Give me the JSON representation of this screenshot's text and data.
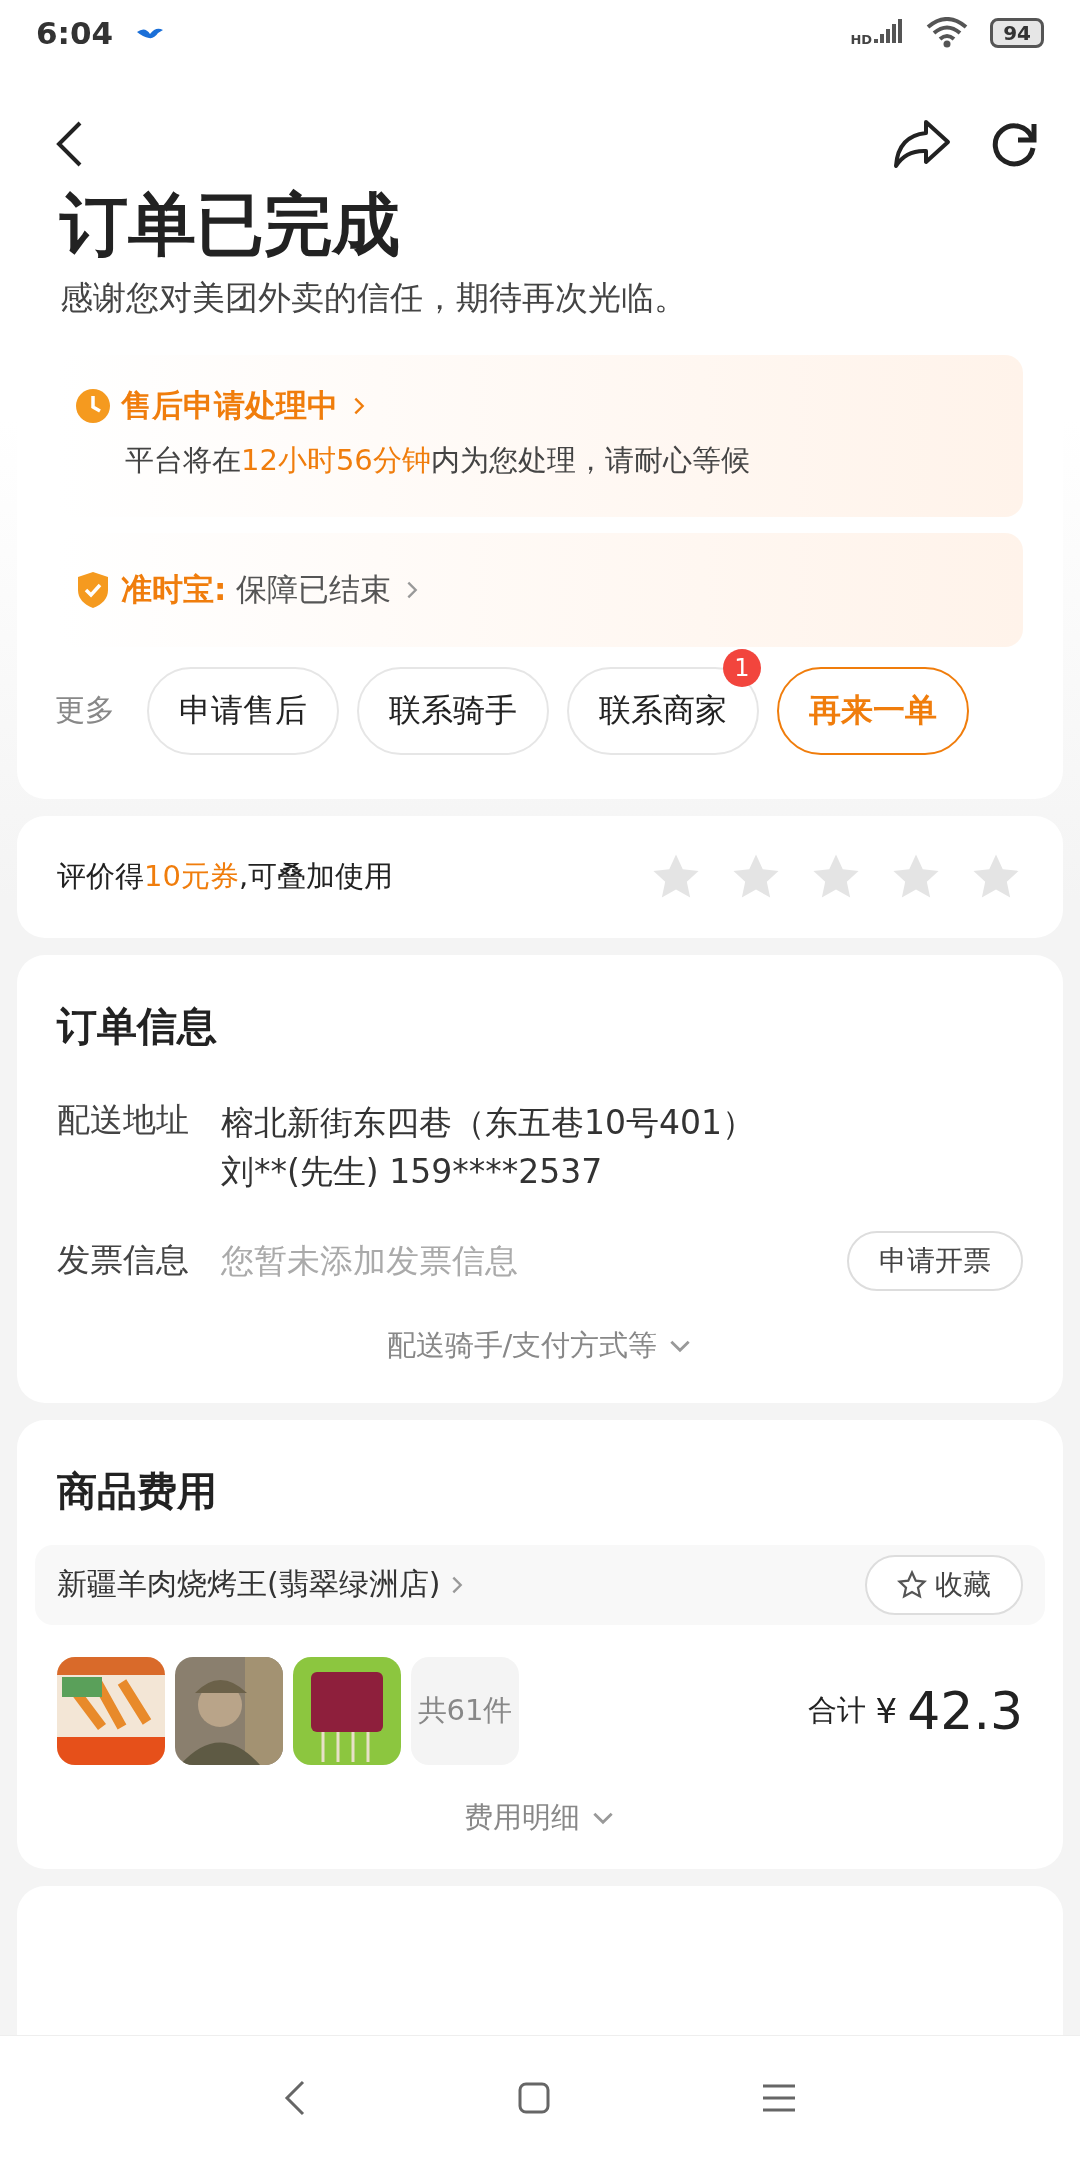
{
  "status_bar": {
    "time": "6:04",
    "network": "HD",
    "battery": "94"
  },
  "header": {
    "title": "订单已完成",
    "subtitle": "感谢您对美团外卖的信任，期待再次光临。"
  },
  "after_sale": {
    "title": "售后申请处理中",
    "message": [
      {
        "text": "平台将在",
        "highlight": false
      },
      {
        "text": "12小时56分钟",
        "highlight": true
      },
      {
        "text": "内为您处理，请耐心等候",
        "highlight": false
      }
    ]
  },
  "guarantee": {
    "label": "准时宝:",
    "value": "保障已结束"
  },
  "actions": {
    "more_label": "更多",
    "buttons": [
      {
        "label": "申请售后",
        "kind": "plain"
      },
      {
        "label": "联系骑手",
        "kind": "plain"
      },
      {
        "label": "联系商家",
        "kind": "plain",
        "badge": "1"
      },
      {
        "label": "再来一单",
        "kind": "primary"
      }
    ]
  },
  "review": {
    "text": [
      {
        "text": "评价得",
        "highlight": false
      },
      {
        "text": "10元券",
        "highlight": true
      },
      {
        "text": ",可叠加使用",
        "highlight": false
      }
    ],
    "stars": 0
  },
  "order_info": {
    "title": "订单信息",
    "rows": [
      {
        "kind": "address",
        "label": "配送地址",
        "lines": [
          "榕北新街东四巷（东五巷10号401）",
          "刘**(先生) 159****2537"
        ]
      },
      {
        "kind": "invoice",
        "label": "发票信息",
        "lines": [
          "您暂未添加发票信息"
        ],
        "empty": true,
        "button": "申请开票"
      }
    ],
    "more": "配送骑手/支付方式等"
  },
  "goods": {
    "title": "商品费用",
    "store": "新疆羊肉烧烤王(翡翠绿洲店)",
    "favorite": "收藏",
    "count": "共61件",
    "total_label": "合计",
    "currency": "¥",
    "total": "42.3",
    "details": "费用明细"
  }
}
